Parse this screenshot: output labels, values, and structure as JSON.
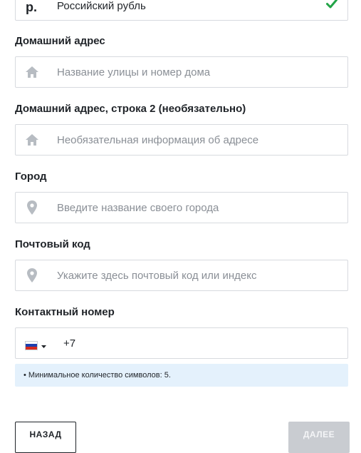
{
  "currency": {
    "symbol": "р.",
    "name": "Российский рубль",
    "selected": true,
    "check_color": "#22a447"
  },
  "address": {
    "label": "Домашний адрес",
    "placeholder": "Название улицы и номер дома",
    "icon": "home-icon"
  },
  "address2": {
    "label": "Домашний адрес, строка 2 (необязательно)",
    "placeholder": "Необязательная информация об адресе",
    "icon": "home-icon"
  },
  "city": {
    "label": "Город",
    "placeholder": "Введите название своего города",
    "icon": "location-pin-icon"
  },
  "postal": {
    "label": "Почтовый код",
    "placeholder": "Укажите здесь почтовый код или индекс",
    "icon": "location-pin-icon"
  },
  "phone": {
    "label": "Контактный номер",
    "country_flag": "russia-flag-icon",
    "value": "+7",
    "hint": "• Минимальное количество символов: 5."
  },
  "buttons": {
    "back_label": "НАЗАД",
    "next_label": "ДАЛЕЕ",
    "next_disabled": true
  },
  "colors": {
    "icon_gray": "#b7bcc2",
    "hint_bg": "#e4f1fc",
    "disabled_button": "#c9ccd1",
    "border": "#d7dadf"
  }
}
